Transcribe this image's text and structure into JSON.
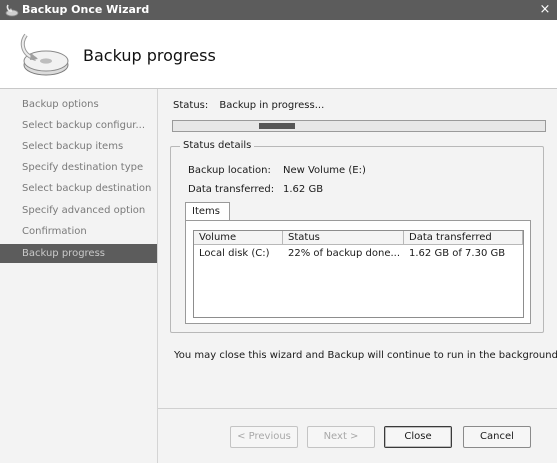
{
  "window": {
    "title": "Backup Once Wizard",
    "close_glyph": "×"
  },
  "header": {
    "title": "Backup progress",
    "icon": "backup-disk-icon"
  },
  "nav": {
    "items": [
      {
        "label": "Backup options"
      },
      {
        "label": "Select backup configur..."
      },
      {
        "label": "Select backup items"
      },
      {
        "label": "Specify destination type"
      },
      {
        "label": "Select backup destination"
      },
      {
        "label": "Specify advanced option"
      },
      {
        "label": "Confirmation"
      },
      {
        "label": "Backup progress"
      }
    ],
    "active_index": 7
  },
  "main": {
    "status_label": "Status:",
    "status_value": "Backup in progress...",
    "progress_indicator": "marquee",
    "status_details_title": "Status details",
    "backup_location_label": "Backup location:",
    "backup_location_value": "New Volume (E:)",
    "data_transferred_label": "Data transferred:",
    "data_transferred_value": "1.62 GB",
    "tab_items": "Items",
    "table": {
      "columns": [
        "Volume",
        "Status",
        "Data transferred"
      ],
      "rows": [
        [
          "Local disk (C:)",
          "22% of backup done...",
          "1.62 GB of 7.30 GB"
        ]
      ]
    },
    "note": "You may close this wizard and Backup will continue to run in the background."
  },
  "footer": {
    "previous_label": "< Previous",
    "next_label": "Next >",
    "close_label": "Close",
    "cancel_label": "Cancel"
  },
  "colors": {
    "titlebar": "#5c5c5c",
    "nav_active_bg": "#5c5c5c",
    "panel_bg": "#f3f3f3"
  }
}
